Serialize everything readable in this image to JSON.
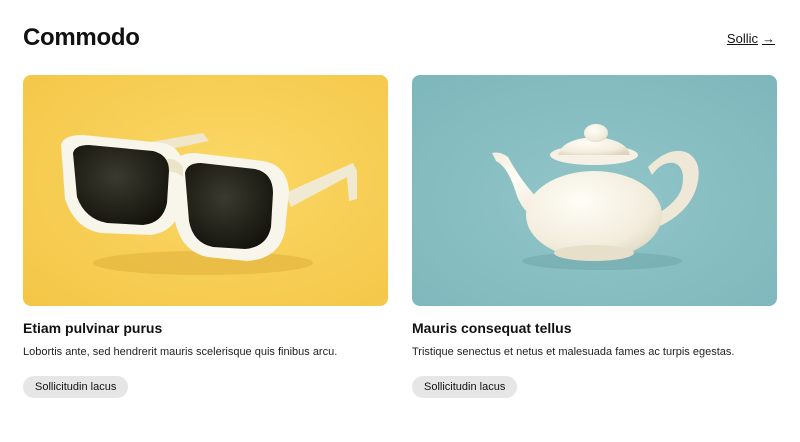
{
  "section": {
    "title": "Commodo",
    "see_all_label": "Sollic",
    "see_all_arrow": "→"
  },
  "cards": [
    {
      "title": "Etiam pulvinar purus",
      "description": "Lobortis ante, sed hendrerit mauris scelerisque quis finibus arcu.",
      "tag": "Sollicitudin lacus",
      "image": "sunglasses-photo",
      "background": "#f7cf55"
    },
    {
      "title": "Mauris consequat tellus",
      "description": "Tristique senectus et netus et malesuada fames ac turpis egestas.",
      "tag": "Sollicitudin lacus",
      "image": "teapot-photo",
      "background": "#84bcc0"
    }
  ]
}
